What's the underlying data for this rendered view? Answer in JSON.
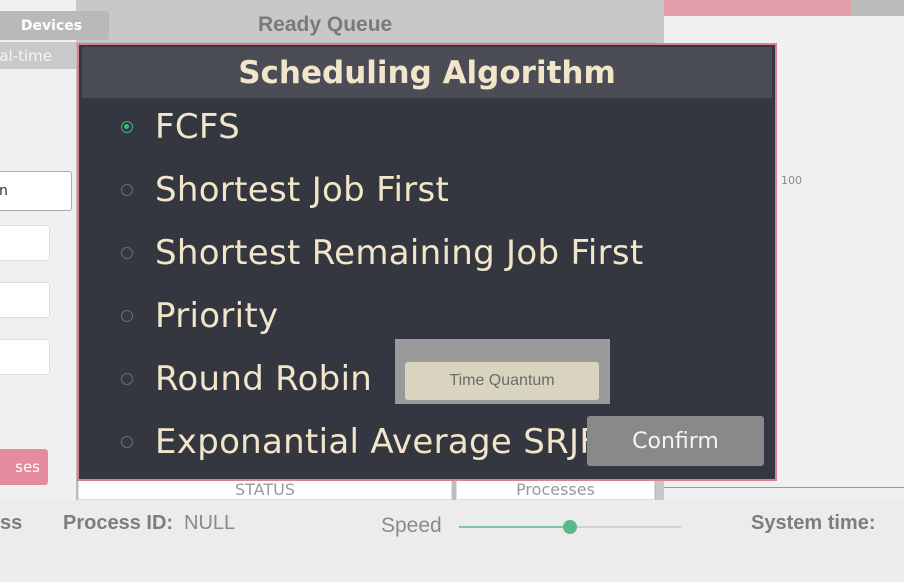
{
  "background": {
    "devices_button": "Devices",
    "realtime_tab": "al-time",
    "left_input_partial": "n",
    "processes_button": "ses",
    "ready_queue_title": "Ready Queue",
    "status_tab": "STATUS",
    "processes_tab": "Processes",
    "chart_tick": "100"
  },
  "status_bar": {
    "left_partial": "ss",
    "process_id_label": "Process ID:",
    "process_id_value": "NULL",
    "speed_label": "Speed",
    "speed_value": 0.5,
    "system_time_label": "System time:"
  },
  "modal": {
    "title": "Scheduling Algorithm",
    "options": [
      {
        "label": "FCFS",
        "selected": true
      },
      {
        "label": "Shortest Job First",
        "selected": false
      },
      {
        "label": "Shortest Remaining Job First",
        "selected": false
      },
      {
        "label": "Priority",
        "selected": false
      },
      {
        "label": "Round Robin",
        "selected": false
      },
      {
        "label": "Exponantial Average SRJF",
        "selected": false
      }
    ],
    "time_quantum_placeholder": "Time Quantum",
    "confirm_label": "Confirm"
  },
  "colors": {
    "modal_bg": "#343740",
    "modal_border": "#d9828f",
    "accent_green": "#39b878",
    "text_cream": "#f2e5c9"
  }
}
